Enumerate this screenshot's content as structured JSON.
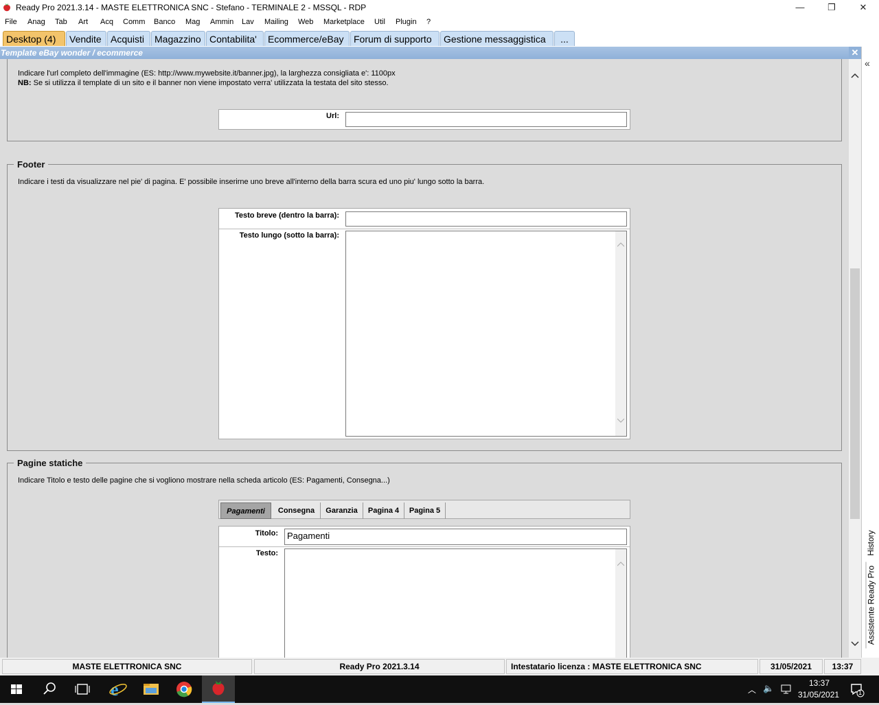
{
  "window": {
    "title": "Ready Pro 2021.3.14 - MASTE ELETTRONICA SNC - Stefano - TERMINALE 2 - MSSQL - RDP",
    "minimize": "—",
    "maximize": "❐",
    "close": "✕"
  },
  "menu": [
    "File",
    "Anag",
    "Tab",
    "Art",
    "Acq",
    "Comm",
    "Banco",
    "Mag",
    "Ammin",
    "Lav",
    "Mailing",
    "Web",
    "Marketplace",
    "Util",
    "Plugin",
    "?"
  ],
  "tabs": [
    "Desktop (4)",
    "Vendite",
    "Acquisti",
    "Magazzino",
    "Contabilita'",
    "Ecommerce/eBay",
    "Forum di supporto",
    "Gestione messaggistica",
    "..."
  ],
  "panel": {
    "title": "Template eBay wonder / ecommerce",
    "close": "✕"
  },
  "banner": {
    "desc1": "Indicare l'url completo dell'immagine (ES: http://www.mywebsite.it/banner.jpg), la larghezza consigliata e': 1100px",
    "nb_label": "NB:",
    "desc2": "Se si utilizza il template di un sito e il banner non viene impostato verra' utilizzata la testata del sito stesso.",
    "url_label": "Url:",
    "url_value": ""
  },
  "footer": {
    "legend": "Footer",
    "desc": "Indicare i testi da visualizzare nel pie' di pagina. E' possibile inserirne uno breve all'interno della barra scura ed uno piu' lungo sotto la barra.",
    "short_label": "Testo breve (dentro la barra):",
    "short_value": "",
    "long_label": "Testo lungo (sotto la barra):",
    "long_value": ""
  },
  "static_pages": {
    "legend": "Pagine statiche",
    "desc": "Indicare Titolo e testo delle pagine che si vogliono mostrare nella scheda articolo (ES: Pagamenti, Consegna...)",
    "tabs": [
      "Pagamenti",
      "Consegna",
      "Garanzia",
      "Pagina 4",
      "Pagina 5"
    ],
    "active_tab": "Pagamenti",
    "title_label": "Titolo:",
    "title_value": "Pagamenti",
    "text_label": "Testo:",
    "text_value": ""
  },
  "side": {
    "collapse": "«",
    "history": "History",
    "assistant": "Assistente Ready Pro"
  },
  "status": {
    "company": "MASTE ELETTRONICA SNC",
    "version": "Ready Pro 2021.3.14",
    "license": "Intestatario licenza : MASTE ELETTRONICA SNC",
    "date": "31/05/2021",
    "time": "13:37"
  },
  "taskbar": {
    "time": "13:37",
    "date": "31/05/2021",
    "notifications": "1"
  }
}
